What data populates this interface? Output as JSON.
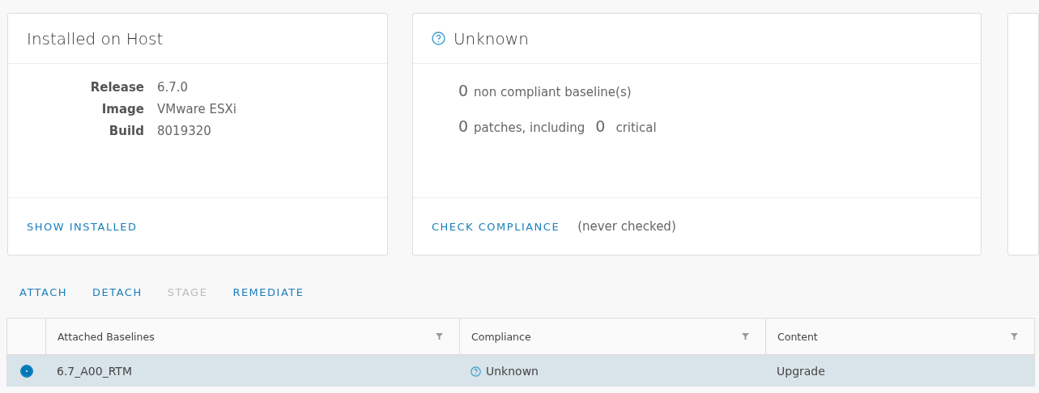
{
  "installed_card": {
    "title": "Installed on Host",
    "properties": [
      {
        "label": "Release",
        "value": "6.7.0"
      },
      {
        "label": "Image",
        "value": "VMware ESXi"
      },
      {
        "label": "Build",
        "value": "8019320"
      }
    ],
    "action": "SHOW INSTALLED"
  },
  "compliance_card": {
    "title": "Unknown",
    "baselines_count": "0",
    "baselines_text": "non compliant baseline(s)",
    "patches_count": "0",
    "patches_text": "patches, including",
    "critical_count": "0",
    "critical_text": "critical",
    "action": "CHECK COMPLIANCE",
    "note": "(never checked)"
  },
  "actions": [
    {
      "label": "ATTACH",
      "disabled": false
    },
    {
      "label": "DETACH",
      "disabled": false
    },
    {
      "label": "STAGE",
      "disabled": true
    },
    {
      "label": "REMEDIATE",
      "disabled": false
    }
  ],
  "table": {
    "columns": [
      "Attached Baselines",
      "Compliance",
      "Content"
    ],
    "rows": [
      {
        "selected": true,
        "baseline": "6.7_A00_RTM",
        "compliance": "Unknown",
        "content": "Upgrade"
      }
    ]
  }
}
